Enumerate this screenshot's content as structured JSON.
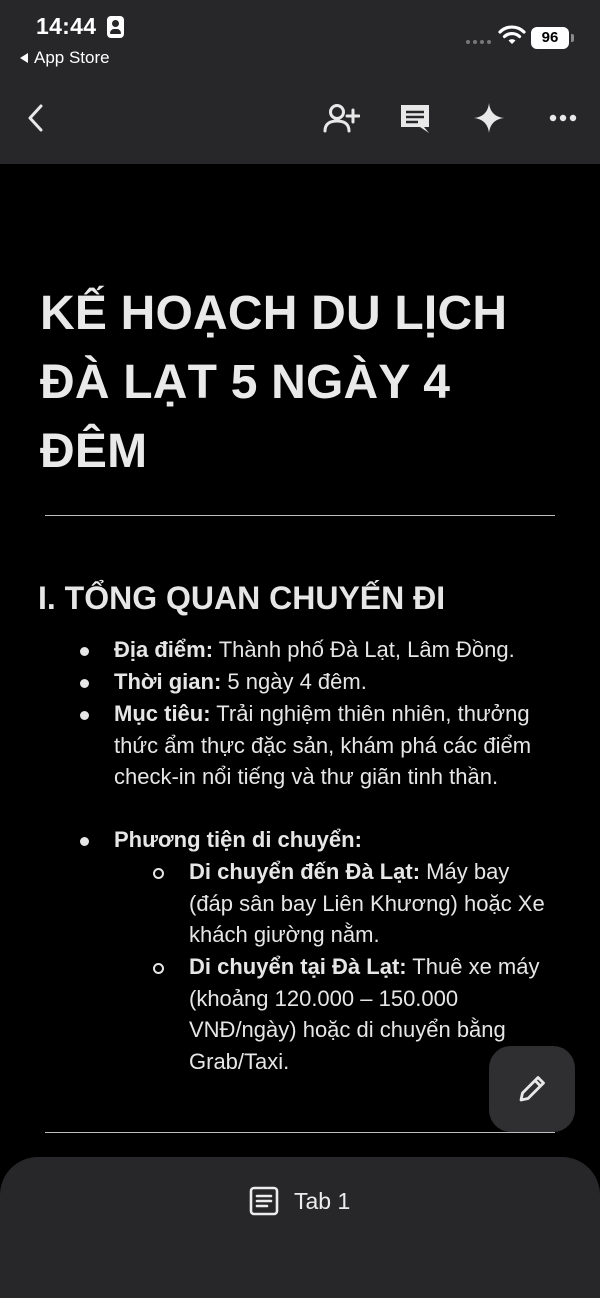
{
  "status_bar": {
    "time": "14:44",
    "back_app_label": "App Store",
    "battery": "96"
  },
  "toolbar": {
    "icons": [
      "back-icon",
      "add-person-icon",
      "comment-icon",
      "sparkle-icon",
      "more-icon"
    ]
  },
  "document": {
    "title": "KẾ HOẠCH DU LỊCH ĐÀ LẠT 5 NGÀY 4 ĐÊM",
    "section_heading": "I. TỔNG QUAN CHUYẾN ĐI",
    "items": [
      {
        "label": "Địa điểm:",
        "text": " Thành phố Đà Lạt, Lâm Đồng."
      },
      {
        "label": "Thời gian:",
        "text": " 5 ngày 4 đêm."
      },
      {
        "label": "Mục tiêu:",
        "text": " Trải nghiệm thiên nhiên, thưởng thức ẩm thực đặc sản, khám phá các điểm check-in nổi tiếng và thư giãn tinh thần."
      },
      {
        "label": "Phương tiện di chuyển:",
        "text": ""
      }
    ],
    "sub_items": [
      {
        "label": "Di chuyển đến Đà Lạt:",
        "text": " Máy bay (đáp sân bay Liên Khương) hoặc Xe khách giường nằm."
      },
      {
        "label": "Di chuyển tại Đà Lạt:",
        "text": " Thuê xe máy (khoảng 120.000 – 150.000 VNĐ/ngày) hoặc di chuyển bằng Grab/Taxi."
      }
    ]
  },
  "bottom_bar": {
    "tab_label": "Tab 1"
  },
  "colors": {
    "toolbar_bg": "#27272a",
    "page_bg": "#000000",
    "text": "#e6e6e6"
  }
}
